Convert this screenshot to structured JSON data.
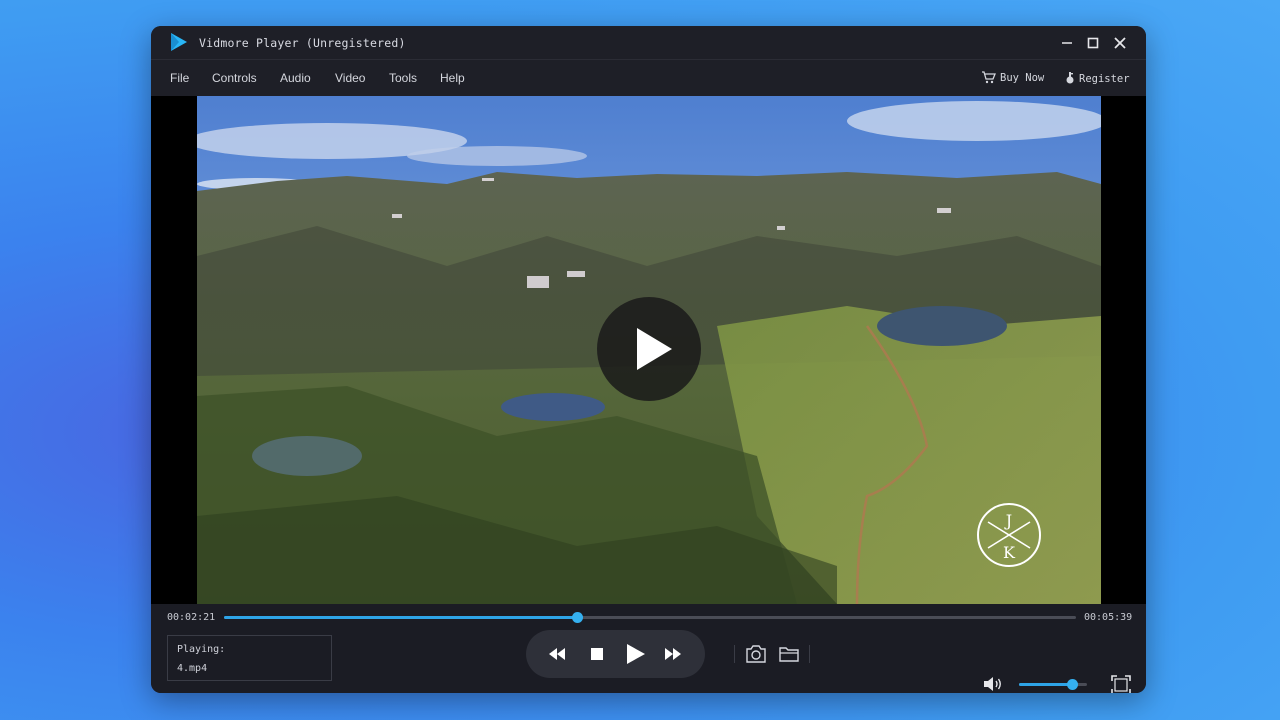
{
  "window": {
    "title": "Vidmore Player (Unregistered)"
  },
  "menu": {
    "items": [
      "File",
      "Controls",
      "Audio",
      "Video",
      "Tools",
      "Help"
    ],
    "buy_now": "Buy Now",
    "register": "Register"
  },
  "player": {
    "current_time": "00:02:21",
    "total_time": "00:05:39",
    "progress_fraction": 0.414,
    "volume_fraction": 0.78,
    "playing_label": "Playing:",
    "file_name": "4.mp4"
  },
  "watermark": {
    "text_top": "J",
    "text_bottom": "K"
  },
  "colors": {
    "accent": "#2ea4e8",
    "window_bg": "#1b1c24",
    "logo": "#29b6f6"
  }
}
